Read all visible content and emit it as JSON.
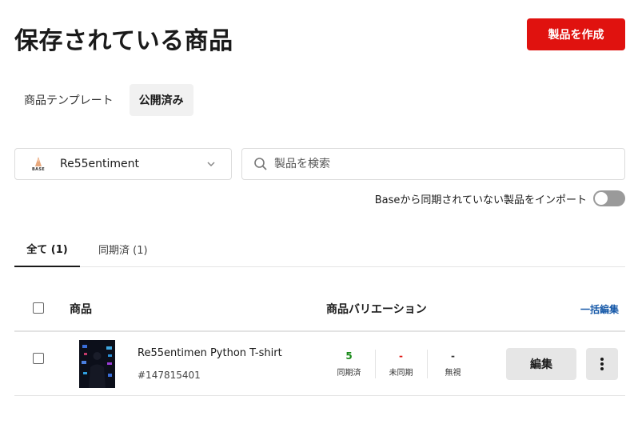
{
  "header": {
    "title": "保存されている商品",
    "create_label": "製品を作成"
  },
  "segment_tabs": [
    {
      "label": "商品テンプレート"
    },
    {
      "label": "公開済み"
    }
  ],
  "shop": {
    "logo_text": "BASE",
    "name": "Re55entiment"
  },
  "search": {
    "placeholder": "製品を検索"
  },
  "import": {
    "label": "Baseから同期されていない製品をインポート",
    "enabled": false
  },
  "filter_tabs": [
    {
      "label": "全て (1)"
    },
    {
      "label": "同期済 (1)"
    }
  ],
  "table": {
    "header_product": "商品",
    "header_variation": "商品バリエーション",
    "bulk_edit": "一括編集",
    "rows": [
      {
        "name": "Re55entimen Python T-shirt",
        "id": "#147815401",
        "stats": [
          {
            "value": "5",
            "label": "同期済"
          },
          {
            "value": "-",
            "label": "未同期"
          },
          {
            "value": "-",
            "label": "無視"
          }
        ],
        "edit_label": "編集"
      }
    ]
  },
  "colors": {
    "primary": "#e0120f",
    "synced": "#1a8a1a",
    "unsynced": "#e0120f",
    "link": "#1558a8"
  }
}
